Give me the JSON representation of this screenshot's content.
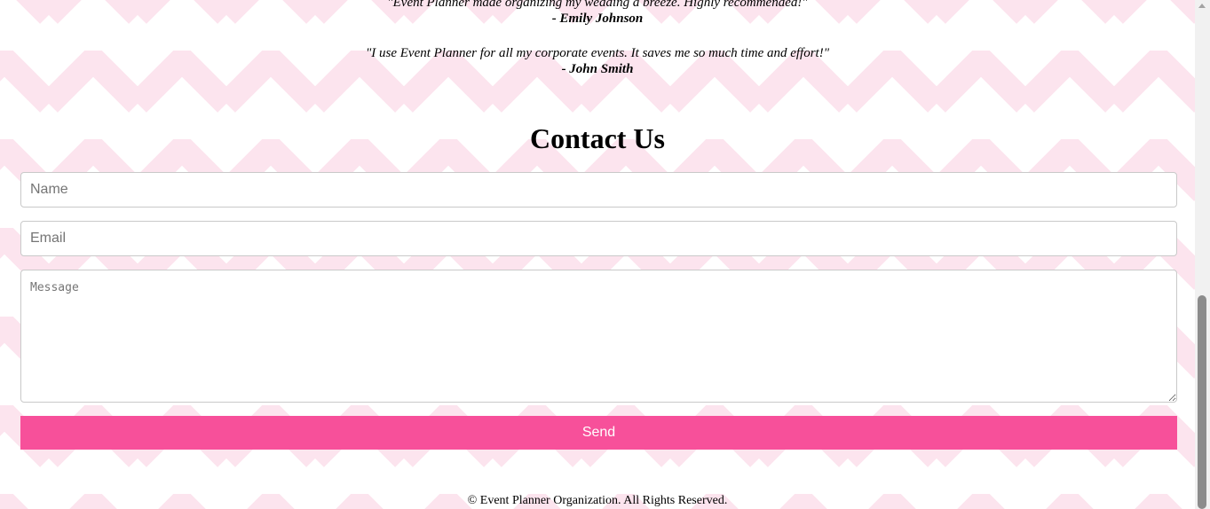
{
  "testimonials": [
    {
      "quote": "\"Event Planner made organizing my wedding a breeze. Highly recommended!\"",
      "author": "- Emily Johnson"
    },
    {
      "quote": "\"I use Event Planner for all my corporate events. It saves me so much time and effort!\"",
      "author": "- John Smith"
    }
  ],
  "contact": {
    "title": "Contact Us",
    "name_placeholder": "Name",
    "email_placeholder": "Email",
    "message_placeholder": "Message",
    "send_label": "Send"
  },
  "footer": {
    "text": "© Event Planner Organization. All Rights Reserved."
  },
  "colors": {
    "background_pattern": "#fce4ee",
    "accent": "#f7509a"
  },
  "scroll_position_fraction": 1.0
}
